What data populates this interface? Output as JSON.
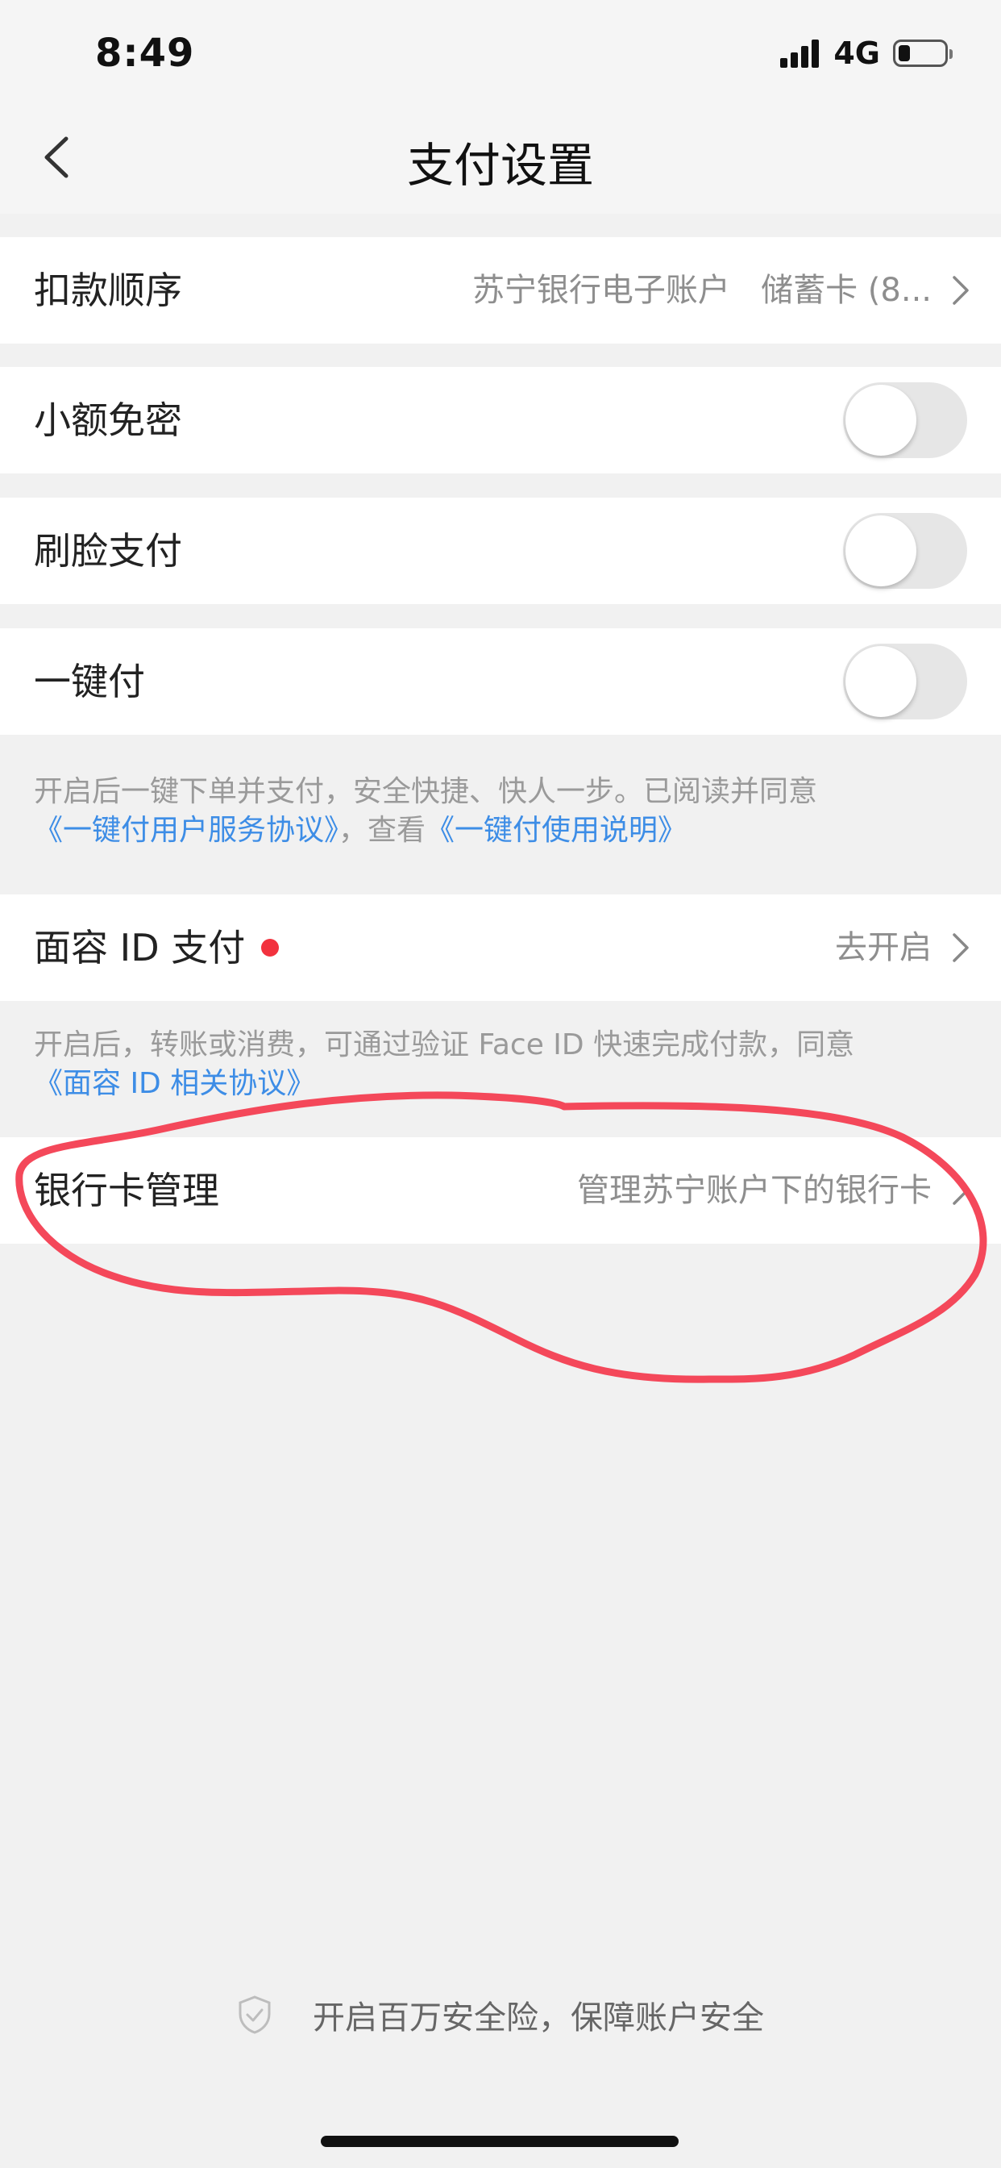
{
  "status_bar": {
    "time": "8:49",
    "network": "4G",
    "battery_level": 0.25
  },
  "nav": {
    "title": "支付设置",
    "back_icon": "chevron-left-icon"
  },
  "rows": {
    "deduction_order": {
      "label": "扣款顺序",
      "value": "苏宁银行电子账户   储蓄卡 (8..."
    },
    "small_no_password": {
      "label": "小额免密",
      "enabled": false
    },
    "face_pay": {
      "label": "刷脸支付",
      "enabled": false
    },
    "one_click_pay": {
      "label": "一键付",
      "enabled": false,
      "desc_prefix": "开启后一键下单并支付，安全快捷、快人一步。已阅读并同意",
      "link1": "《一键付用户服务协议》",
      "desc_middle": "，查看",
      "link2": "《一键付使用说明》"
    },
    "face_id_pay": {
      "label": "面容 ID 支付",
      "value": "去开启",
      "desc": "开启后，转账或消费，可通过验证 Face ID 快速完成付款，同意",
      "link": "《面容 ID 相关协议》"
    },
    "bank_card": {
      "label": "银行卡管理",
      "value": "管理苏宁账户下的银行卡"
    }
  },
  "footer": {
    "text": "开启百万安全险，保障账户安全",
    "icon": "shield-check-icon"
  },
  "colors": {
    "link": "#3D8DE6",
    "badge": "#F2323E",
    "annotation": "#F4485A",
    "background": "#F1F1F1"
  }
}
